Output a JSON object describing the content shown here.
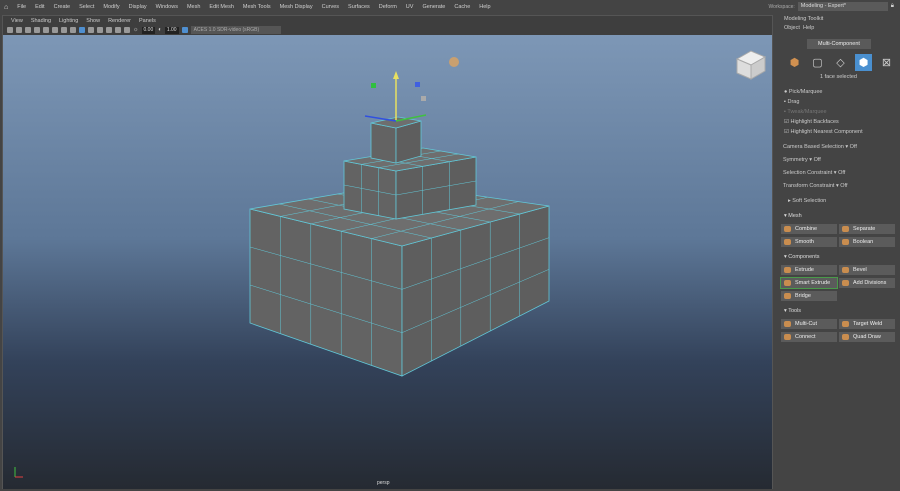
{
  "menubar": {
    "items": [
      "File",
      "Edit",
      "Create",
      "Select",
      "Modify",
      "Display",
      "Windows",
      "Mesh",
      "Edit Mesh",
      "Mesh Tools",
      "Mesh Display",
      "Curves",
      "Surfaces",
      "Deform",
      "UV",
      "Generate",
      "Cache",
      "Help"
    ],
    "workspace_label": "Workspace:",
    "workspace_value": "Modeling - Expert*"
  },
  "viewport": {
    "menu": [
      "View",
      "Shading",
      "Lighting",
      "Show",
      "Renderer",
      "Panels"
    ],
    "exposure": "0.00",
    "gamma": "1.00",
    "color_space": "ACES 1.0 SDR-video (sRGB)",
    "camera": "persp"
  },
  "toolkit": {
    "title": "Modeling Toolkit",
    "menu": [
      "Object",
      "Help"
    ],
    "mode": "Multi-Component",
    "status": "1 face selected",
    "options": [
      "Pick/Marquee",
      "Drag",
      "Tweak/Marquee"
    ],
    "checks": [
      "Highlight Backfaces",
      "Highlight Nearest Component"
    ],
    "dropdowns": [
      {
        "label": "Camera Based Selection",
        "value": "Off"
      },
      {
        "label": "Symmetry",
        "value": "Off"
      },
      {
        "label": "Selection Constraint",
        "value": "Off"
      },
      {
        "label": "Transform Constraint",
        "value": "Off"
      }
    ],
    "soft_selection": "Soft Selection",
    "sections": [
      {
        "title": "Mesh",
        "buttons": [
          "Combine",
          "Separate",
          "Smooth",
          "Boolean"
        ]
      },
      {
        "title": "Components",
        "buttons": [
          "Extrude",
          "Bevel",
          "Smart Extrude",
          "Add Divisions",
          "Bridge"
        ]
      },
      {
        "title": "Tools",
        "buttons": [
          "Multi-Cut",
          "Target Weld",
          "Connect",
          "Quad Draw"
        ]
      }
    ]
  },
  "colors": {
    "accent": "#4a90d0",
    "wire": "#62c8d8",
    "mesh": "#6a6a6a"
  }
}
